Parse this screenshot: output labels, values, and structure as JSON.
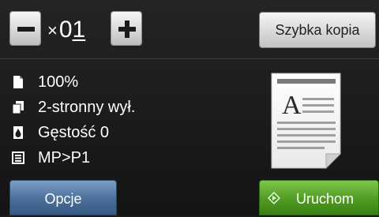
{
  "copies": {
    "times_symbol": "×",
    "digit_tens": "0",
    "digit_ones": "1"
  },
  "buttons": {
    "quick_copy_label": "Szybka kopia",
    "options_label": "Opcje",
    "start_label": "Uruchom"
  },
  "settings": [
    {
      "icon": "page-icon",
      "label": "100%"
    },
    {
      "icon": "duplex-icon",
      "label": "2-stronny wył."
    },
    {
      "icon": "density-drop-icon",
      "label": "Gęstość 0"
    },
    {
      "icon": "tray-icon",
      "label": "MP>P1"
    }
  ],
  "preview": {
    "letter": "A"
  },
  "colors": {
    "options_button": "#4a6f99",
    "start_button": "#4f9b24",
    "background": "#1c1c1c"
  }
}
